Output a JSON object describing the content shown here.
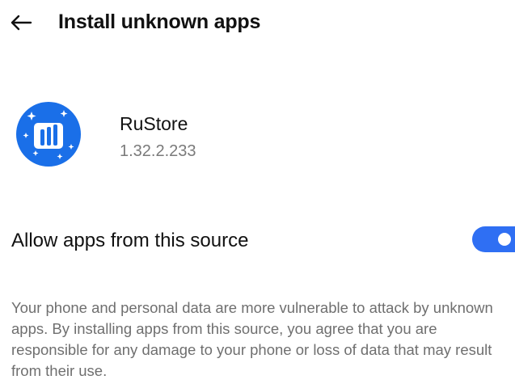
{
  "header": {
    "back_icon": "arrow-left-icon",
    "title": "Install unknown apps"
  },
  "app": {
    "icon": "rustore-app-icon",
    "icon_color": "#1a6fe8",
    "name": "RuStore",
    "version": "1.32.2.233"
  },
  "setting": {
    "label": "Allow apps from this source",
    "enabled": true,
    "toggle_color": "#2f6ff3"
  },
  "warning": {
    "text": "Your phone and personal data are more vulnerable to attack by unknown apps. By installing apps from this source, you agree that you are responsible for any damage to your phone or loss of data that may result from their use."
  }
}
